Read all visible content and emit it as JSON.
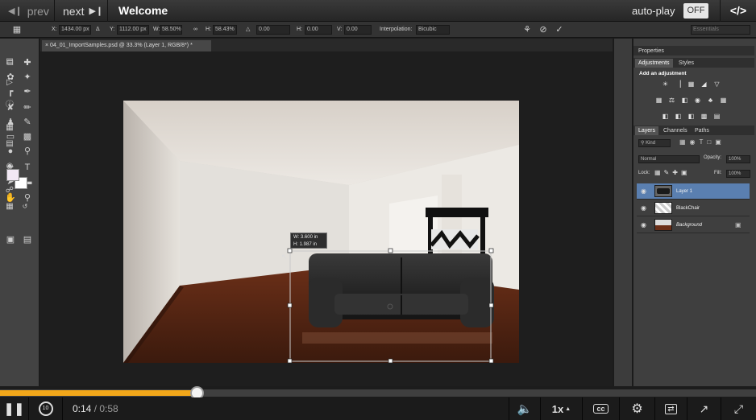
{
  "player": {
    "prev_label": "prev",
    "next_label": "next",
    "title": "Welcome",
    "autoplay_label": "auto-play",
    "autoplay_state": "OFF",
    "code_label": "</>",
    "current_time": "0:14",
    "separator": " / ",
    "total_time": "0:58",
    "progress": 0.26,
    "speed_label": "1x",
    "cc_label": "cc",
    "replay_label": "10",
    "accent_color": "#f2a71a"
  },
  "options_bar": {
    "x_label": "X:",
    "x_value": "1434.00 px",
    "y_label": "Y:",
    "y_value": "1112.00 px",
    "w_label": "W:",
    "w_value": "58.50%",
    "h_label": "H:",
    "h_value": "58.43%",
    "angle_value": "0.00",
    "hskew_label": "H:",
    "hskew_value": "0.00",
    "vskew_label": "V:",
    "vskew_value": "0.00",
    "interp_label": "Interpolation:",
    "interp_value": "Bicubic",
    "workspace": "Essentials"
  },
  "document": {
    "tab_label": "04_01_ImportSamples.psd @ 33.3% (Layer 1, RGB/8*) *",
    "transform_w": "W: 3.600 in",
    "transform_h": "H: 1.987 in"
  },
  "panels": {
    "tab_properties": "Properties",
    "tab_adjustments": "Adjustments",
    "tab_styles": "Styles",
    "add_adjustment": "Add an adjustment",
    "tab_layers": "Layers",
    "tab_channels": "Channels",
    "tab_paths": "Paths",
    "kind_label": "Kind",
    "blend_mode": "Normal",
    "opacity_label": "Opacity:",
    "opacity_value": "100%",
    "lock_label": "Lock:",
    "fill_label": "Fill:",
    "fill_value": "100%",
    "layers": [
      {
        "name": "Layer 1"
      },
      {
        "name": "BlackChair"
      },
      {
        "name": "Background"
      }
    ]
  }
}
